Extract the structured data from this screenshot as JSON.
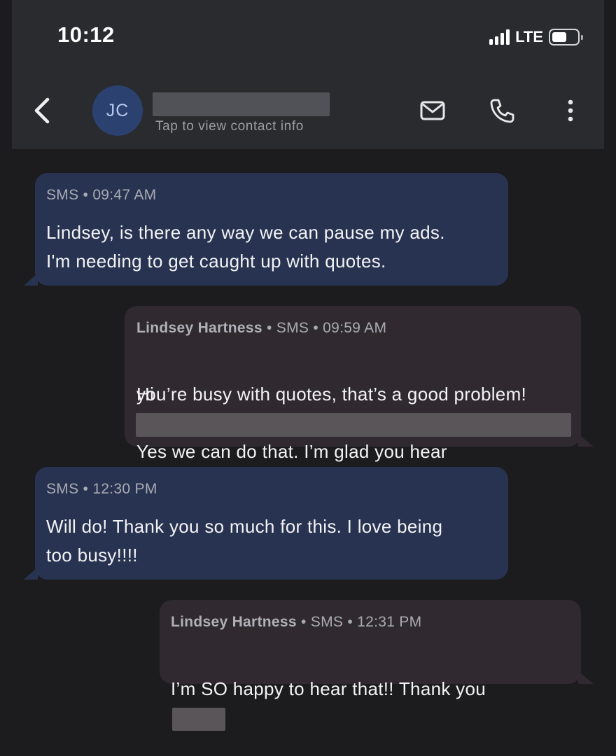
{
  "status_bar": {
    "time": "10:12",
    "network": "LTE",
    "battery_level": 0.6
  },
  "header": {
    "avatar_initials": "JC",
    "contact_hint": "Tap to view contact info",
    "icons": [
      "back-arrow-icon",
      "mail-icon",
      "phone-icon",
      "more-vertical-icon"
    ]
  },
  "messages": [
    {
      "direction": "incoming",
      "meta": "SMS • 09:47 AM",
      "text": "Lindsey, is there any way we can pause my ads.\nI'm needing to get caught up with quotes."
    },
    {
      "direction": "outgoing",
      "sender": "Lindsey Hartness",
      "meta": " • SMS • 09:59 AM",
      "text_before_redaction": "Hi",
      "text_after_redaction": "Yes we can do that. I’m glad you hear",
      "text_line2": "you’re busy with quotes, that’s a good problem!"
    },
    {
      "direction": "incoming",
      "meta": "SMS • 12:30 PM",
      "text": "Will do!  Thank you so much for this.  I love being\ntoo busy!!!!"
    },
    {
      "direction": "outgoing",
      "sender": "Lindsey Hartness",
      "meta": " • SMS • 12:31 PM",
      "text": "I’m SO happy to hear that!! Thank you"
    }
  ],
  "colors": {
    "background": "#1c1c1e",
    "header": "#2a2b2f",
    "incoming_bubble": "#273350",
    "outgoing_bubble": "#302a30",
    "avatar": "#2b4270"
  }
}
